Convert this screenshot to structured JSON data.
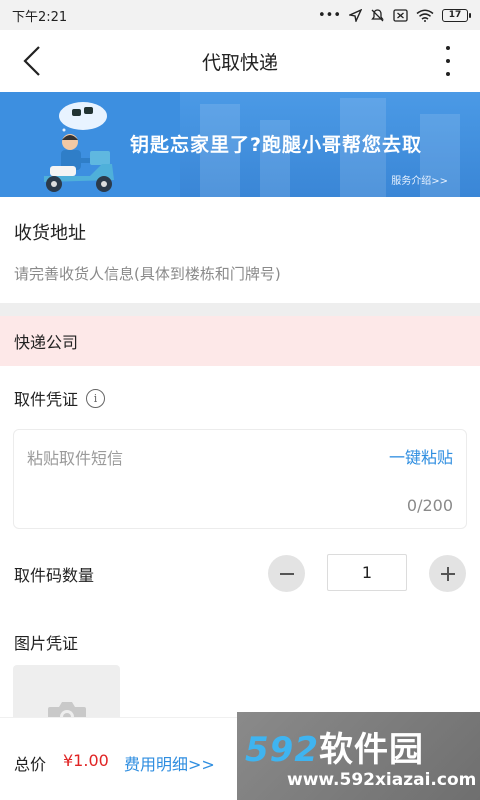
{
  "status_bar": {
    "time": "下午2:21",
    "icons": [
      "dots-icon",
      "location-icon",
      "mute-icon",
      "sim-icon",
      "wifi-icon"
    ],
    "battery": "17"
  },
  "header": {
    "title": "代取快递",
    "back_icon": "chevron-left-icon",
    "more_icon": "more-vertical-icon"
  },
  "banner": {
    "slogan": "钥匙忘家里了?跑腿小哥帮您去取",
    "link": "服务介绍>>",
    "bg_color": "#3d8fe0"
  },
  "address": {
    "title": "收货地址",
    "hint": "请完善收货人信息(具体到楼栋和门牌号)"
  },
  "courier": {
    "label": "快递公司",
    "highlight_color": "#fde8e8"
  },
  "voucher": {
    "title": "取件凭证",
    "info_icon": "i",
    "sms_placeholder": "粘贴取件短信",
    "paste_label": "一键粘贴",
    "char_count": "0/200"
  },
  "quantity": {
    "label": "取件码数量",
    "value": "1"
  },
  "photo": {
    "label": "图片凭证"
  },
  "bottom": {
    "total_label": "总价",
    "total_price": "¥1.00",
    "fee_detail": "费用明细>>",
    "price_color": "#e02424",
    "link_color": "#2f8ee0"
  },
  "watermark": {
    "logo_digits": "592",
    "logo_text": "软件园",
    "url": "www.592xiazai.com"
  }
}
